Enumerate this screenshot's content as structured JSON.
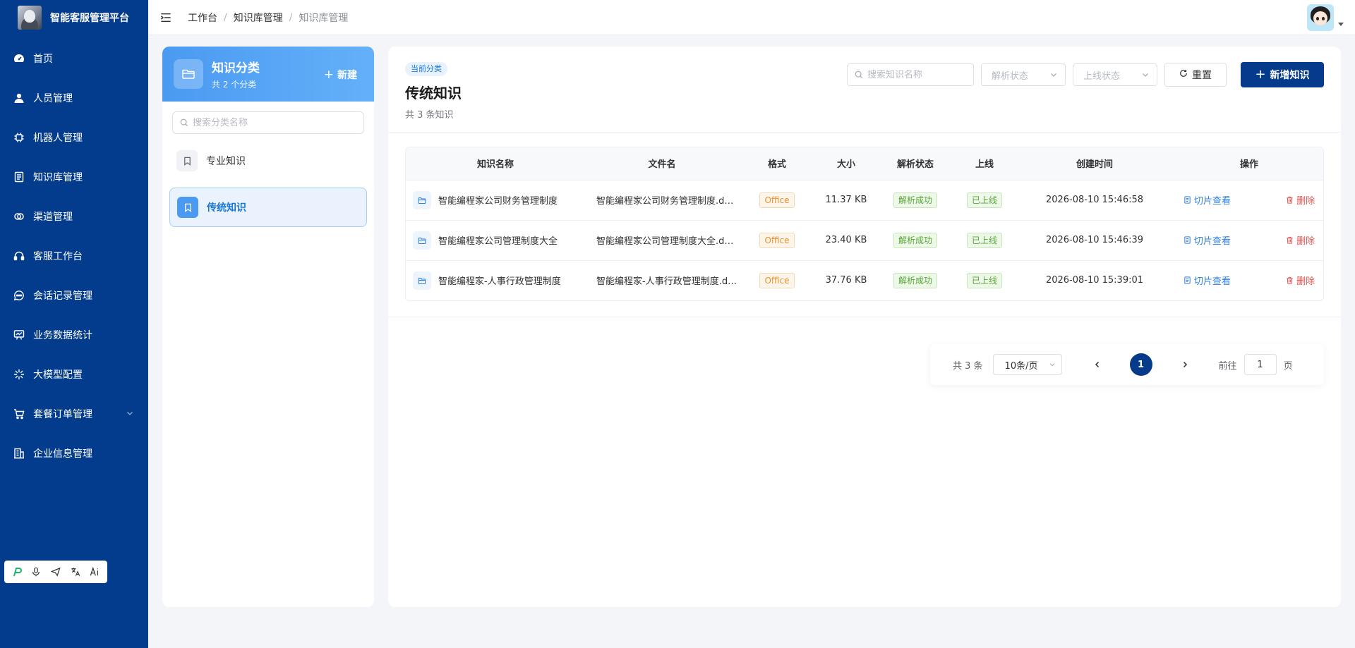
{
  "brand": {
    "title": "智能客服管理平台"
  },
  "menu": [
    {
      "label": "首页",
      "icon": "dashboard-icon"
    },
    {
      "label": "人员管理",
      "icon": "user-icon"
    },
    {
      "label": "机器人管理",
      "icon": "chip-icon"
    },
    {
      "label": "知识库管理",
      "icon": "document-icon"
    },
    {
      "label": "渠道管理",
      "icon": "link-icon"
    },
    {
      "label": "客服工作台",
      "icon": "headset-icon"
    },
    {
      "label": "会话记录管理",
      "icon": "chat-icon"
    },
    {
      "label": "业务数据统计",
      "icon": "presentation-chart-icon"
    },
    {
      "label": "大模型配置",
      "icon": "sparkle-icon"
    },
    {
      "label": "套餐订单管理",
      "icon": "cart-icon"
    },
    {
      "label": "企业信息管理",
      "icon": "building-icon"
    }
  ],
  "breadcrumb": [
    "工作台",
    "知识库管理",
    "知识库管理"
  ],
  "category": {
    "title": "知识分类",
    "subtitle": "共 2 个分类",
    "new_label": "新建",
    "search_placeholder": "搜索分类名称",
    "items": [
      {
        "label": "专业知识",
        "active": false
      },
      {
        "label": "传统知识",
        "active": true
      }
    ]
  },
  "main": {
    "badge": "当前分类",
    "title": "传统知识",
    "subtitle": "共 3 条知识",
    "search_placeholder": "搜索知识名称",
    "parse_status_placeholder": "解析状态",
    "online_status_placeholder": "上线状态",
    "reset_label": "重置",
    "add_label": "新增知识"
  },
  "table": {
    "columns": [
      "知识名称",
      "文件名",
      "格式",
      "大小",
      "解析状态",
      "上线",
      "创建时间",
      "操作"
    ],
    "rows": [
      {
        "name": "智能编程家公司财务管理制度",
        "file": "智能编程家公司财务管理制度.docx",
        "format": "Office",
        "size": "11.37 KB",
        "parse": "解析成功",
        "online": "已上线",
        "created": "2026-08-10 15:46:58",
        "view": "切片查看",
        "delete": "删除"
      },
      {
        "name": "智能编程家公司管理制度大全",
        "file": "智能编程家公司管理制度大全.docx",
        "format": "Office",
        "size": "23.40 KB",
        "parse": "解析成功",
        "online": "已上线",
        "created": "2026-08-10 15:46:39",
        "view": "切片查看",
        "delete": "删除"
      },
      {
        "name": "智能编程家-人事行政管理制度",
        "file": "智能编程家-人事行政管理制度.docx",
        "format": "Office",
        "size": "37.76 KB",
        "parse": "解析成功",
        "online": "已上线",
        "created": "2026-08-10 15:39:01",
        "view": "切片查看",
        "delete": "删除"
      }
    ]
  },
  "pager": {
    "total": "共 3 条",
    "page_size": "10条/页",
    "current": "1",
    "goto_label": "前往",
    "goto_value": "1",
    "page_suffix": "页"
  },
  "colors": {
    "sidebar": "#033c8c",
    "primary": "#063a8a",
    "accent": "#4a9af2",
    "success": "#55a636",
    "warning": "#e6912e",
    "danger": "#e5524f"
  }
}
